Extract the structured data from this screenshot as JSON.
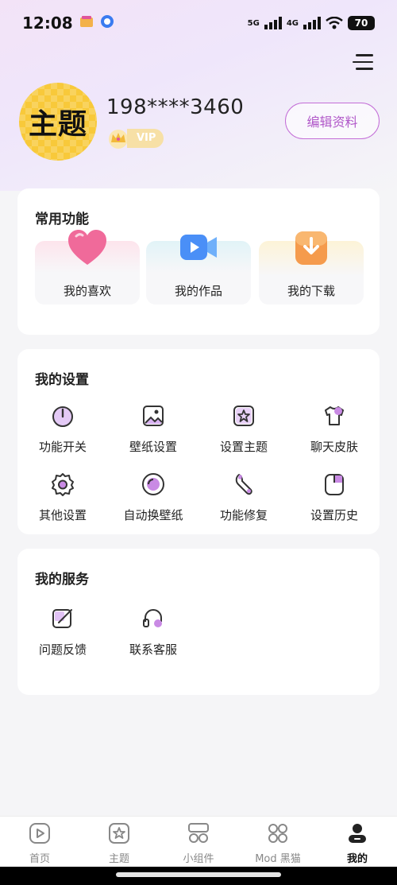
{
  "status_bar": {
    "time": "12:08",
    "network_1": "5G",
    "network_2": "4G",
    "battery": "70"
  },
  "profile": {
    "avatar_text": "主题",
    "username": "198****3460",
    "vip_label": "VIP",
    "edit_button": "编辑资料"
  },
  "common_functions": {
    "title": "常用功能",
    "items": [
      {
        "label": "我的喜欢",
        "icon": "heart-icon",
        "color": "#f06a9a"
      },
      {
        "label": "我的作品",
        "icon": "video-camera-icon",
        "color": "#4a8ff7"
      },
      {
        "label": "我的下载",
        "icon": "download-icon",
        "color": "#f59b4c"
      }
    ]
  },
  "my_settings": {
    "title": "我的设置",
    "items": [
      {
        "label": "功能开关",
        "icon": "power-icon"
      },
      {
        "label": "壁纸设置",
        "icon": "image-icon"
      },
      {
        "label": "设置主题",
        "icon": "theme-star-icon"
      },
      {
        "label": "聊天皮肤",
        "icon": "tshirt-icon"
      },
      {
        "label": "其他设置",
        "icon": "gear-icon"
      },
      {
        "label": "自动换壁纸",
        "icon": "auto-wallpaper-icon"
      },
      {
        "label": "功能修复",
        "icon": "wrench-icon"
      },
      {
        "label": "设置历史",
        "icon": "history-icon"
      }
    ]
  },
  "my_services": {
    "title": "我的服务",
    "items": [
      {
        "label": "问题反馈",
        "icon": "feedback-edit-icon"
      },
      {
        "label": "联系客服",
        "icon": "headset-icon"
      }
    ]
  },
  "bottom_nav": {
    "items": [
      {
        "label": "首页",
        "icon": "play-home-icon",
        "active": false
      },
      {
        "label": "主题",
        "icon": "theme-star-icon",
        "active": false
      },
      {
        "label": "小组件",
        "icon": "widget-icon",
        "active": false
      },
      {
        "label": "Mod 黑猫",
        "icon": "mod-grid-icon",
        "active": false
      },
      {
        "label": "我的",
        "icon": "profile-icon",
        "active": true
      }
    ]
  },
  "colors": {
    "accent": "#b158c9",
    "accent_light": "#d9b3f2",
    "icon_stroke": "#333333"
  }
}
